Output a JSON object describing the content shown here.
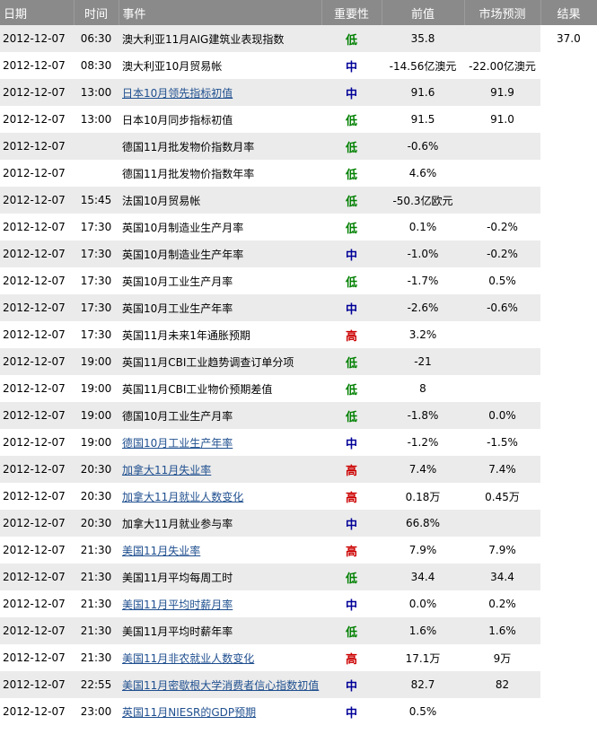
{
  "headers": {
    "date": "日期",
    "time": "时间",
    "event": "事件",
    "importance": "重要性",
    "previous": "前值",
    "forecast": "市场预测",
    "actual": "结果"
  },
  "importance_colors": {
    "低": "#008000",
    "中": "#000099",
    "高": "#cc0000"
  },
  "rows": [
    {
      "date": "2012-12-07",
      "time": "06:30",
      "event": "澳大利亚11月AIG建筑业表现指数",
      "link": false,
      "importance": "低",
      "previous": "35.8",
      "forecast": "",
      "actual": "37.0"
    },
    {
      "date": "2012-12-07",
      "time": "08:30",
      "event": "澳大利亚10月贸易帐",
      "link": false,
      "importance": "中",
      "previous": "-14.56亿澳元",
      "forecast": "-22.00亿澳元",
      "actual": ""
    },
    {
      "date": "2012-12-07",
      "time": "13:00",
      "event": "日本10月领先指标初值",
      "link": true,
      "importance": "中",
      "previous": "91.6",
      "forecast": "91.9",
      "actual": ""
    },
    {
      "date": "2012-12-07",
      "time": "13:00",
      "event": "日本10月同步指标初值",
      "link": false,
      "importance": "低",
      "previous": "91.5",
      "forecast": "91.0",
      "actual": ""
    },
    {
      "date": "2012-12-07",
      "time": "",
      "event": "德国11月批发物价指数月率",
      "link": false,
      "importance": "低",
      "previous": "-0.6%",
      "forecast": "",
      "actual": ""
    },
    {
      "date": "2012-12-07",
      "time": "",
      "event": "德国11月批发物价指数年率",
      "link": false,
      "importance": "低",
      "previous": "4.6%",
      "forecast": "",
      "actual": ""
    },
    {
      "date": "2012-12-07",
      "time": "15:45",
      "event": "法国10月贸易帐",
      "link": false,
      "importance": "低",
      "previous": "-50.3亿欧元",
      "forecast": "",
      "actual": ""
    },
    {
      "date": "2012-12-07",
      "time": "17:30",
      "event": "英国10月制造业生产月率",
      "link": false,
      "importance": "低",
      "previous": "0.1%",
      "forecast": "-0.2%",
      "actual": ""
    },
    {
      "date": "2012-12-07",
      "time": "17:30",
      "event": "英国10月制造业生产年率",
      "link": false,
      "importance": "中",
      "previous": "-1.0%",
      "forecast": "-0.2%",
      "actual": ""
    },
    {
      "date": "2012-12-07",
      "time": "17:30",
      "event": "英国10月工业生产月率",
      "link": false,
      "importance": "低",
      "previous": "-1.7%",
      "forecast": "0.5%",
      "actual": ""
    },
    {
      "date": "2012-12-07",
      "time": "17:30",
      "event": "英国10月工业生产年率",
      "link": false,
      "importance": "中",
      "previous": "-2.6%",
      "forecast": "-0.6%",
      "actual": ""
    },
    {
      "date": "2012-12-07",
      "time": "17:30",
      "event": "英国11月未来1年通胀预期",
      "link": false,
      "importance": "高",
      "previous": "3.2%",
      "forecast": "",
      "actual": ""
    },
    {
      "date": "2012-12-07",
      "time": "19:00",
      "event": "英国11月CBI工业趋势调查订单分项",
      "link": false,
      "importance": "低",
      "previous": "-21",
      "forecast": "",
      "actual": ""
    },
    {
      "date": "2012-12-07",
      "time": "19:00",
      "event": "英国11月CBI工业物价预期差值",
      "link": false,
      "importance": "低",
      "previous": "8",
      "forecast": "",
      "actual": ""
    },
    {
      "date": "2012-12-07",
      "time": "19:00",
      "event": "德国10月工业生产月率",
      "link": false,
      "importance": "低",
      "previous": "-1.8%",
      "forecast": "0.0%",
      "actual": ""
    },
    {
      "date": "2012-12-07",
      "time": "19:00",
      "event": "德国10月工业生产年率",
      "link": true,
      "importance": "中",
      "previous": "-1.2%",
      "forecast": "-1.5%",
      "actual": ""
    },
    {
      "date": "2012-12-07",
      "time": "20:30",
      "event": "加拿大11月失业率",
      "link": true,
      "importance": "高",
      "previous": "7.4%",
      "forecast": "7.4%",
      "actual": ""
    },
    {
      "date": "2012-12-07",
      "time": "20:30",
      "event": "加拿大11月就业人数变化",
      "link": true,
      "importance": "高",
      "previous": "0.18万",
      "forecast": "0.45万",
      "actual": ""
    },
    {
      "date": "2012-12-07",
      "time": "20:30",
      "event": "加拿大11月就业参与率",
      "link": false,
      "importance": "中",
      "previous": "66.8%",
      "forecast": "",
      "actual": ""
    },
    {
      "date": "2012-12-07",
      "time": "21:30",
      "event": "美国11月失业率",
      "link": true,
      "importance": "高",
      "previous": "7.9%",
      "forecast": "7.9%",
      "actual": ""
    },
    {
      "date": "2012-12-07",
      "time": "21:30",
      "event": "美国11月平均每周工时",
      "link": false,
      "importance": "低",
      "previous": "34.4",
      "forecast": "34.4",
      "actual": ""
    },
    {
      "date": "2012-12-07",
      "time": "21:30",
      "event": "美国11月平均时薪月率",
      "link": true,
      "importance": "中",
      "previous": "0.0%",
      "forecast": "0.2%",
      "actual": ""
    },
    {
      "date": "2012-12-07",
      "time": "21:30",
      "event": "美国11月平均时薪年率",
      "link": false,
      "importance": "低",
      "previous": "1.6%",
      "forecast": "1.6%",
      "actual": ""
    },
    {
      "date": "2012-12-07",
      "time": "21:30",
      "event": "美国11月非农就业人数变化",
      "link": true,
      "importance": "高",
      "previous": "17.1万",
      "forecast": "9万",
      "actual": ""
    },
    {
      "date": "2012-12-07",
      "time": "22:55",
      "event": "美国11月密歇根大学消费者信心指数初值",
      "link": true,
      "importance": "中",
      "previous": "82.7",
      "forecast": "82",
      "actual": ""
    },
    {
      "date": "2012-12-07",
      "time": "23:00",
      "event": "英国11月NIESR的GDP预期",
      "link": true,
      "importance": "中",
      "previous": "0.5%",
      "forecast": "",
      "actual": ""
    }
  ]
}
